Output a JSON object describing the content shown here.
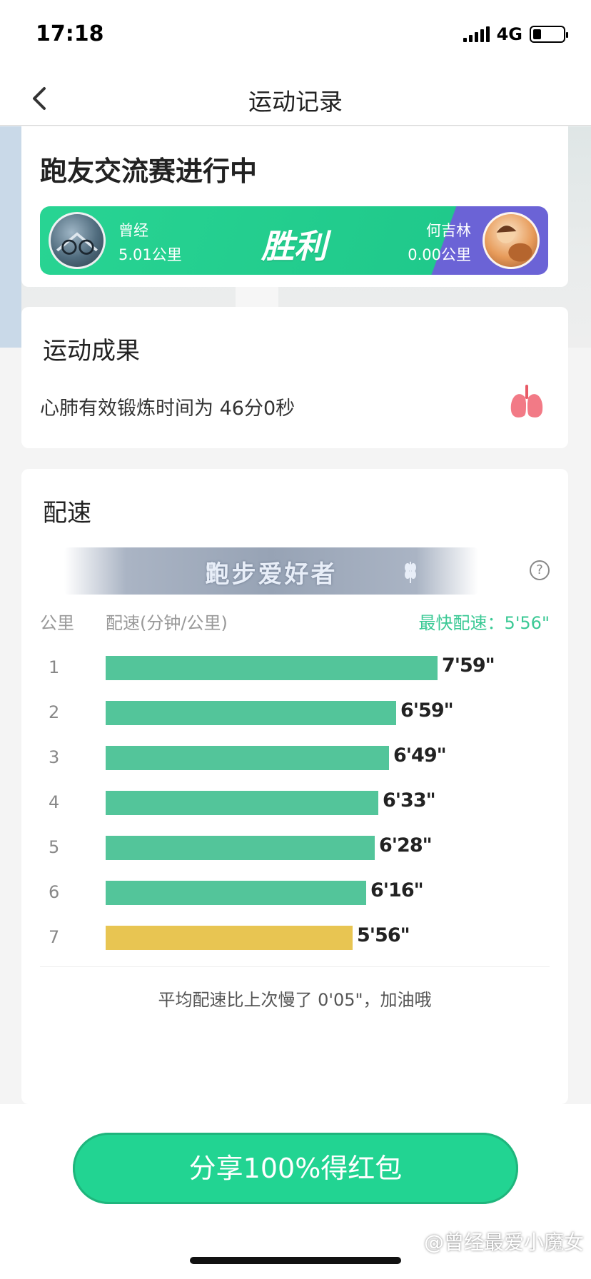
{
  "status_bar": {
    "time": "17:18",
    "network": "4G"
  },
  "nav": {
    "title": "运动记录",
    "back_icon": "chevron-left-icon"
  },
  "race": {
    "title": "跑友交流赛进行中",
    "result_label": "胜利",
    "left_player": {
      "name": "曾经",
      "distance": "5.01公里"
    },
    "right_player": {
      "name": "何吉林",
      "distance": "0.00公里"
    },
    "colors": {
      "green": "#20c98b",
      "purple": "#6b63d6"
    }
  },
  "result": {
    "title": "运动成果",
    "cardio_text": "心肺有效锻炼时间为 46分0秒",
    "icon": "lungs-icon"
  },
  "pace": {
    "title": "配速",
    "banner": "跑步爱好者",
    "col_km": "公里",
    "col_pace": "配速(分钟/公里)",
    "fastest": "最快配速：5'56\"",
    "rows": [
      {
        "km": "1",
        "value": "7'59\"",
        "seconds": 479
      },
      {
        "km": "2",
        "value": "6'59\"",
        "seconds": 419
      },
      {
        "km": "3",
        "value": "6'49\"",
        "seconds": 409
      },
      {
        "km": "4",
        "value": "6'33\"",
        "seconds": 393
      },
      {
        "km": "5",
        "value": "6'28\"",
        "seconds": 388
      },
      {
        "km": "6",
        "value": "6'16\"",
        "seconds": 376
      },
      {
        "km": "7",
        "value": "5'56\"",
        "seconds": 356,
        "fastest": true
      }
    ],
    "bar_color": "#53c59a",
    "fastest_bar_color": "#e8c552",
    "avg_note": "平均配速比上次慢了 0'05\"，加油哦"
  },
  "share": {
    "label": "分享100%得红包",
    "color": "#22d492"
  },
  "watermark": "@曾经最爱小魔女"
}
